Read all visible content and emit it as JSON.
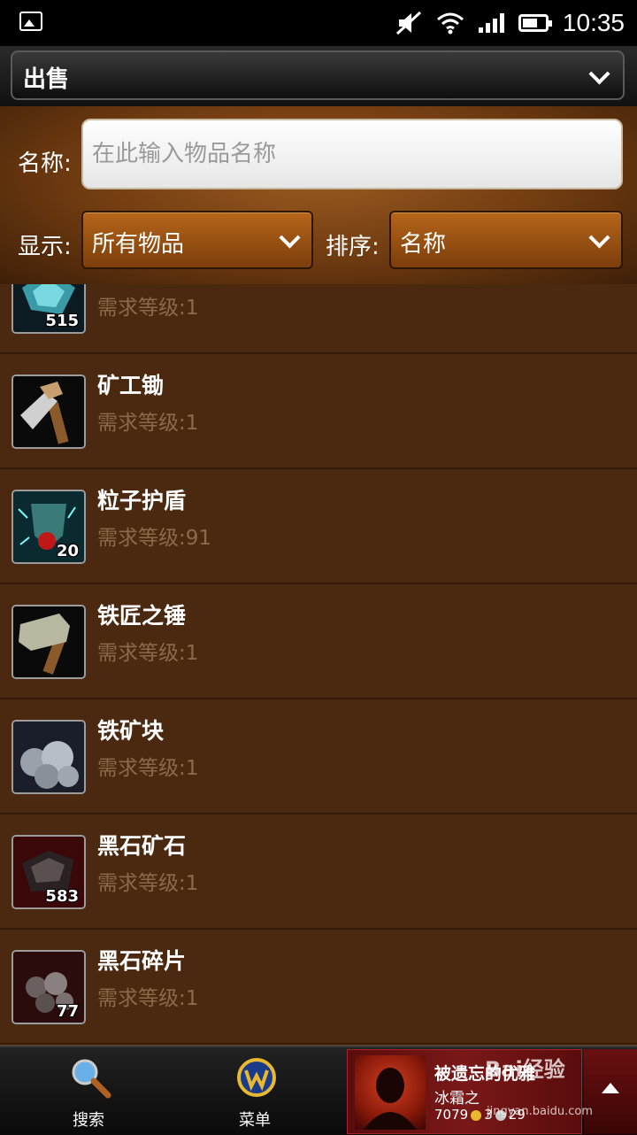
{
  "status_bar": {
    "time": "10:35"
  },
  "header": {
    "mode_label": "出售"
  },
  "filters": {
    "name_label": "名称:",
    "name_placeholder": "在此输入物品名称",
    "display_label": "显示:",
    "display_value": "所有物品",
    "sort_label": "排序:",
    "sort_value": "名称"
  },
  "items": [
    {
      "name": "",
      "level": "需求等级:1",
      "count": "515",
      "icon": "gem-item-icon"
    },
    {
      "name": "矿工锄",
      "level": "需求等级:1",
      "count": "",
      "icon": "mining-pick-icon"
    },
    {
      "name": "粒子护盾",
      "level": "需求等级:91",
      "count": "20",
      "icon": "particle-shield-icon"
    },
    {
      "name": "铁匠之锤",
      "level": "需求等级:1",
      "count": "",
      "icon": "blacksmith-hammer-icon"
    },
    {
      "name": "铁矿块",
      "level": "需求等级:1",
      "count": "",
      "icon": "iron-ore-icon"
    },
    {
      "name": "黑石矿石",
      "level": "需求等级:1",
      "count": "583",
      "icon": "blackrock-ore-icon"
    },
    {
      "name": "黑石碎片",
      "level": "需求等级:1",
      "count": "77",
      "icon": "blackrock-fragment-icon"
    }
  ],
  "bottom_nav": {
    "search_label": "搜索",
    "menu_label": "菜单",
    "character_name": "被遗忘的优雅",
    "character_realm": "冰霜之",
    "gold": "7079",
    "silver": "3",
    "copper": "29"
  },
  "watermark": {
    "brand": "Bai经验",
    "url": "jingyan.baidu.com"
  }
}
